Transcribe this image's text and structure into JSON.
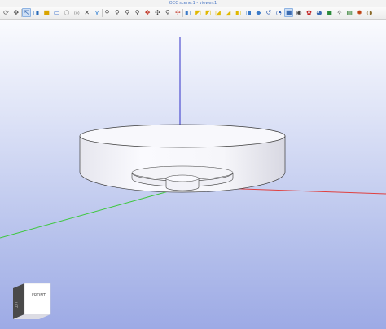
{
  "window": {
    "title": "OCC scene:1 - viewer:1"
  },
  "toolbar": {
    "buttons": [
      {
        "icon": "rotate-view-icon",
        "glyph": "⟳",
        "color": "#555555",
        "active": false
      },
      {
        "icon": "pan-icon",
        "glyph": "✥",
        "color": "#555555",
        "active": false
      },
      {
        "icon": "select-pointer-icon",
        "glyph": "⇱",
        "color": "#3a6ab0",
        "active": true
      },
      {
        "icon": "select-face-icon",
        "glyph": "◨",
        "color": "#2a6bb8",
        "active": false
      },
      {
        "icon": "select-solid-icon",
        "glyph": "■",
        "color": "#d9a400",
        "active": false
      },
      {
        "icon": "rectangle-select-icon",
        "glyph": "▭",
        "color": "#4a7bd0",
        "active": false
      },
      {
        "icon": "polygon-select-icon",
        "glyph": "⬡",
        "color": "#8a8a8a",
        "active": false
      },
      {
        "icon": "circle-select-icon",
        "glyph": "◎",
        "color": "#8a8a8a",
        "active": false
      },
      {
        "icon": "axis-pick-icon",
        "glyph": "✕",
        "color": "#4a4a4a",
        "active": false
      },
      {
        "icon": "filter-icon",
        "glyph": "⋎",
        "color": "#2a7bd0",
        "active": false
      },
      {
        "icon": "zoom-in-icon",
        "glyph": "⚲",
        "color": "#444444",
        "active": false
      },
      {
        "icon": "zoom-window-icon",
        "glyph": "⚲",
        "color": "#444444",
        "active": false
      },
      {
        "icon": "zoom-out-icon",
        "glyph": "⚲",
        "color": "#444444",
        "active": false
      },
      {
        "icon": "zoom-fit-icon",
        "glyph": "⚲",
        "color": "#444444",
        "active": false
      },
      {
        "icon": "pan-arrows-icon",
        "glyph": "✥",
        "color": "#c03020",
        "active": false
      },
      {
        "icon": "global-pan-icon",
        "glyph": "✣",
        "color": "#444444",
        "active": false
      },
      {
        "icon": "zoom-all-icon",
        "glyph": "⚲",
        "color": "#444444",
        "active": false
      },
      {
        "icon": "rotate-axis-icon",
        "glyph": "✢",
        "color": "#c03020",
        "active": false
      },
      {
        "icon": "view-iso-icon",
        "glyph": "◧",
        "color": "#3a7ac8",
        "active": false
      },
      {
        "icon": "view-front-icon",
        "glyph": "◩",
        "color": "#e0b800",
        "active": false
      },
      {
        "icon": "view-back-icon",
        "glyph": "◩",
        "color": "#e0b800",
        "active": false
      },
      {
        "icon": "view-top-icon",
        "glyph": "◪",
        "color": "#e0b800",
        "active": false
      },
      {
        "icon": "view-bottom-icon",
        "glyph": "◪",
        "color": "#e0b800",
        "active": false
      },
      {
        "icon": "view-left-icon",
        "glyph": "◧",
        "color": "#e0b800",
        "active": false
      },
      {
        "icon": "view-right-icon",
        "glyph": "◨",
        "color": "#3a7ac8",
        "active": false
      },
      {
        "icon": "view-axo-icon",
        "glyph": "◆",
        "color": "#3a7ac8",
        "active": false
      },
      {
        "icon": "reset-view-icon",
        "glyph": "↺",
        "color": "#2a5ab0",
        "active": false
      },
      {
        "icon": "clipping-icon",
        "glyph": "◔",
        "color": "#2a5ab0",
        "active": false
      },
      {
        "icon": "shading-icon",
        "glyph": "■",
        "color": "#3a6ab0",
        "active": true
      },
      {
        "icon": "material-icon",
        "glyph": "◉",
        "color": "#444444",
        "active": false
      },
      {
        "icon": "color-icon",
        "glyph": "✿",
        "color": "#c02020",
        "active": false
      },
      {
        "icon": "transparency-icon",
        "glyph": "◕",
        "color": "#3a6ab0",
        "active": false
      },
      {
        "icon": "texture-icon",
        "glyph": "▣",
        "color": "#2a8a3a",
        "active": false
      },
      {
        "icon": "ray-trace-icon",
        "glyph": "✧",
        "color": "#444444",
        "active": false
      },
      {
        "icon": "dump-view-icon",
        "glyph": "▤",
        "color": "#2a7a2a",
        "active": false
      },
      {
        "icon": "env-light-icon",
        "glyph": "✹",
        "color": "#c04010",
        "active": false
      },
      {
        "icon": "settings-icon",
        "glyph": "◑",
        "color": "#8a6a2a",
        "active": false
      }
    ]
  },
  "viewer": {
    "background_top": "#fafbfe",
    "background_bottom": "#9daae5",
    "axis_colors": {
      "x": "#e04040",
      "y": "#3cc83c",
      "z": "#3030c8"
    },
    "shape_color": "#f4f4f8",
    "shape_edge_color": "#3a3a3a"
  },
  "viewcube": {
    "front_label": "FRONT",
    "left_label": "LFT",
    "face_color": "#ffffff",
    "side_color": "#4a4a4a"
  }
}
